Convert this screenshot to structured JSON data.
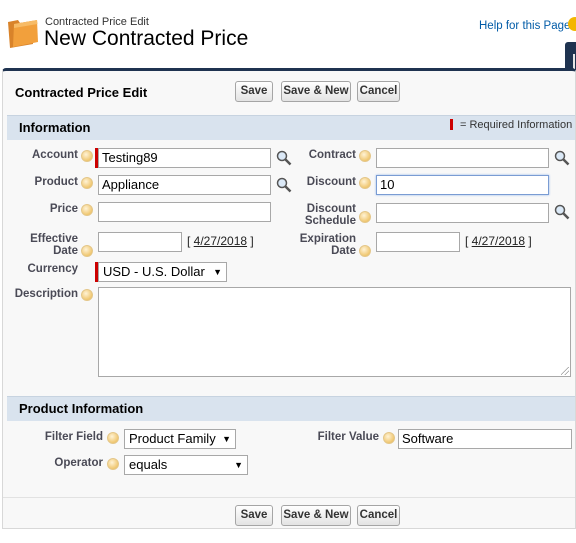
{
  "header": {
    "breadcrumb": "Contracted Price Edit",
    "title": "New Contracted Price",
    "help_link": "Help for this Page"
  },
  "panel": {
    "title": "Contracted Price Edit",
    "buttons": {
      "save": "Save",
      "save_new": "Save & New",
      "cancel": "Cancel"
    }
  },
  "information": {
    "section_title": "Information",
    "required_legend": "= Required Information",
    "account": {
      "label": "Account",
      "value": "Testing89"
    },
    "contract": {
      "label": "Contract",
      "value": ""
    },
    "product": {
      "label": "Product",
      "value": "Appliance"
    },
    "discount": {
      "label": "Discount",
      "value": "10"
    },
    "price": {
      "label": "Price",
      "value": ""
    },
    "discount_schedule": {
      "label1": "Discount",
      "label2": "Schedule",
      "value": ""
    },
    "effective_date": {
      "label1": "Effective",
      "label2": "Date",
      "value": "",
      "today_link": "4/27/2018"
    },
    "expiration_date": {
      "label1": "Expiration",
      "label2": "Date",
      "value": "",
      "today_link": "4/27/2018"
    },
    "currency": {
      "label": "Currency",
      "value": "USD - U.S. Dollar"
    },
    "description": {
      "label": "Description",
      "value": ""
    }
  },
  "product_information": {
    "section_title": "Product Information",
    "filter_field": {
      "label": "Filter Field",
      "value": "Product Family"
    },
    "filter_value": {
      "label": "Filter Value",
      "value": "Software"
    },
    "operator": {
      "label": "Operator",
      "value": "equals"
    }
  },
  "colors": {
    "panel_border": "#1f3350",
    "section_bar": "#d9e3ee",
    "required": "#cc0000",
    "link": "#015ba7"
  }
}
